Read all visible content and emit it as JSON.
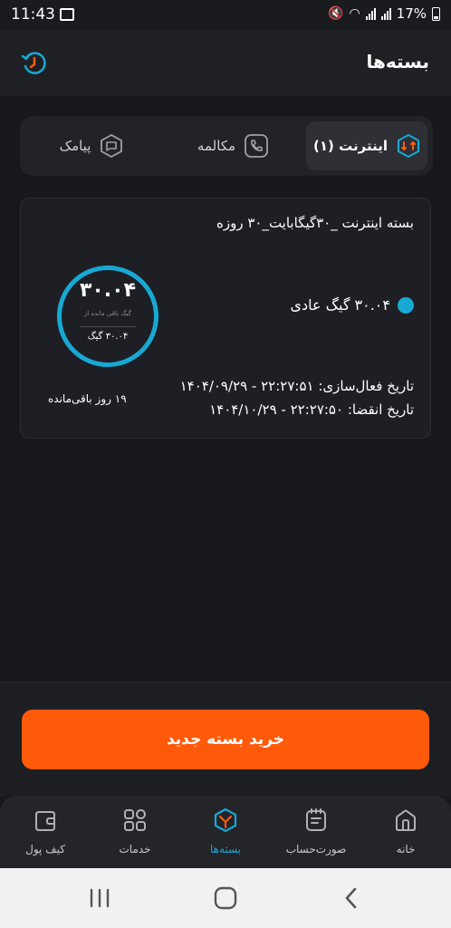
{
  "status_bar": {
    "time": "11:43",
    "battery": "17%"
  },
  "header": {
    "title": "بسته‌ها"
  },
  "tabs": [
    {
      "label": "اینترنت (۱)",
      "icon": "internet-icon",
      "active": true
    },
    {
      "label": "مکالمه",
      "icon": "phone-icon",
      "active": false
    },
    {
      "label": "پیامک",
      "icon": "message-icon",
      "active": false
    }
  ],
  "package": {
    "title": "بسته اینترنت _۳۰گیگابایت_۳۰ روزه",
    "gauge_value": "۳۰.۰۴",
    "gauge_sub": "گیگ باقی مانده از",
    "gauge_total": "۳۰.۰۴ گیگ",
    "remaining_fraction": 1.0,
    "legend_label": "۳۰.۰۴ گیگ عادی",
    "activation": "تاریخ فعال‌سازی: ۲۲:۲۷:۵۱ - ۱۴۰۴/۰۹/۲۹",
    "expiry": "تاریخ انقضا: ۲۲:۲۷:۵۰ - ۱۴۰۴/۱۰/۲۹",
    "days_left": "۱۹ روز باقی‌مانده"
  },
  "buy_button": {
    "label": "خرید بسته جدید"
  },
  "bottom_nav": [
    {
      "label": "خانه",
      "icon": "home-icon",
      "active": false
    },
    {
      "label": "صورت‌حساب",
      "icon": "bill-icon",
      "active": false
    },
    {
      "label": "بسته‌ها",
      "icon": "package-icon",
      "active": true
    },
    {
      "label": "خدمات",
      "icon": "services-icon",
      "active": false
    },
    {
      "label": "کیف پول",
      "icon": "wallet-icon",
      "active": false
    }
  ],
  "colors": {
    "accent": "#17a9d4",
    "buy": "#ff5a0a",
    "background": "#17181c"
  }
}
